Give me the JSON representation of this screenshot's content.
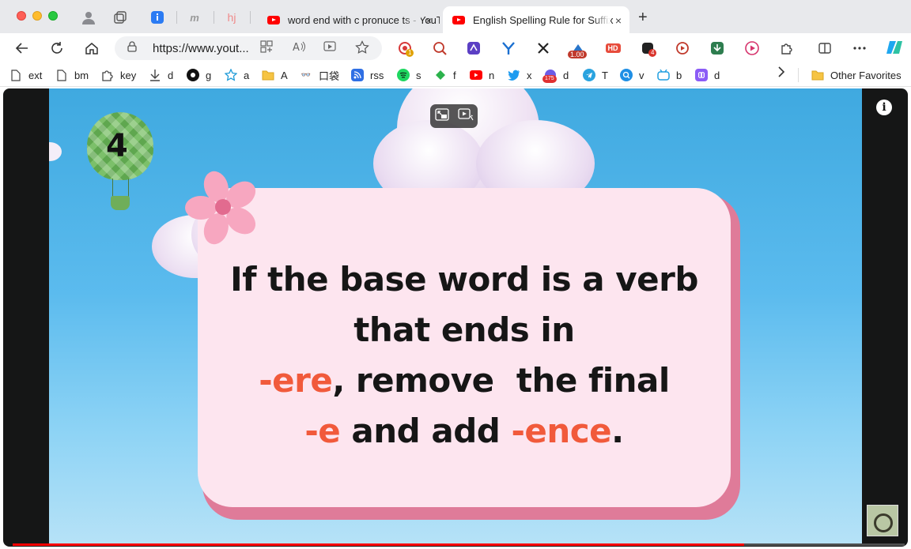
{
  "tabs": {
    "inactive": {
      "title": "word end with c pronuce ts - YouTube",
      "close": "×"
    },
    "active": {
      "title": "English Spelling Rule for Suffix",
      "close": "×"
    },
    "new_tab": "+"
  },
  "pinned": {
    "m_label": "m",
    "hj_label": "hj"
  },
  "address_bar": {
    "url": "https://www.yout..."
  },
  "extensions": {
    "badge_1": "1",
    "speed_badge": "1.00",
    "hd_label": "HD",
    "badge_4": "4"
  },
  "bookmarks": [
    {
      "label": "ext",
      "icon": "page-icon"
    },
    {
      "label": "bm",
      "icon": "page-icon"
    },
    {
      "label": "key",
      "icon": "puzzle-icon"
    },
    {
      "label": "d",
      "icon": "download-icon"
    },
    {
      "label": "g",
      "icon": "github-icon"
    },
    {
      "label": "a",
      "icon": "star-icon"
    },
    {
      "label": "A",
      "icon": "folder-icon"
    },
    {
      "label": "口袋",
      "icon": "pocket-icon"
    },
    {
      "label": "rss",
      "icon": "rss-icon"
    },
    {
      "label": "s",
      "icon": "spotify-icon"
    },
    {
      "label": "f",
      "icon": "feedly-icon"
    },
    {
      "label": "n",
      "icon": "youtube-icon"
    },
    {
      "label": "x",
      "icon": "twitter-icon"
    },
    {
      "label": "d",
      "icon": "counter-icon",
      "badge": "175"
    },
    {
      "label": "T",
      "icon": "telegram-icon"
    },
    {
      "label": "v",
      "icon": "search-v-icon"
    },
    {
      "label": "b",
      "icon": "bilibili-icon"
    },
    {
      "label": "d",
      "icon": "infinity-icon"
    }
  ],
  "other_favorites": "Other Favorites",
  "video": {
    "balloon_number": "4",
    "lines": [
      {
        "parts": [
          {
            "text": "If the base word is a verb",
            "red": false
          }
        ]
      },
      {
        "parts": [
          {
            "text": "that ends in",
            "red": false
          }
        ]
      },
      {
        "parts": [
          {
            "text": "-ere",
            "red": true
          },
          {
            "text": ", remove  the final",
            "red": false
          }
        ]
      },
      {
        "parts": [
          {
            "text": "-e",
            "red": true
          },
          {
            "text": " and add ",
            "red": false
          },
          {
            "text": "-ence",
            "red": true
          },
          {
            "text": ".",
            "red": false
          }
        ]
      }
    ],
    "info": "i",
    "progress": 0.82
  },
  "colors": {
    "accent_red": "#f15a3b",
    "youtube_red": "#ff0000",
    "card_pink": "#fde5ef",
    "card_shadow": "#df7b99"
  }
}
